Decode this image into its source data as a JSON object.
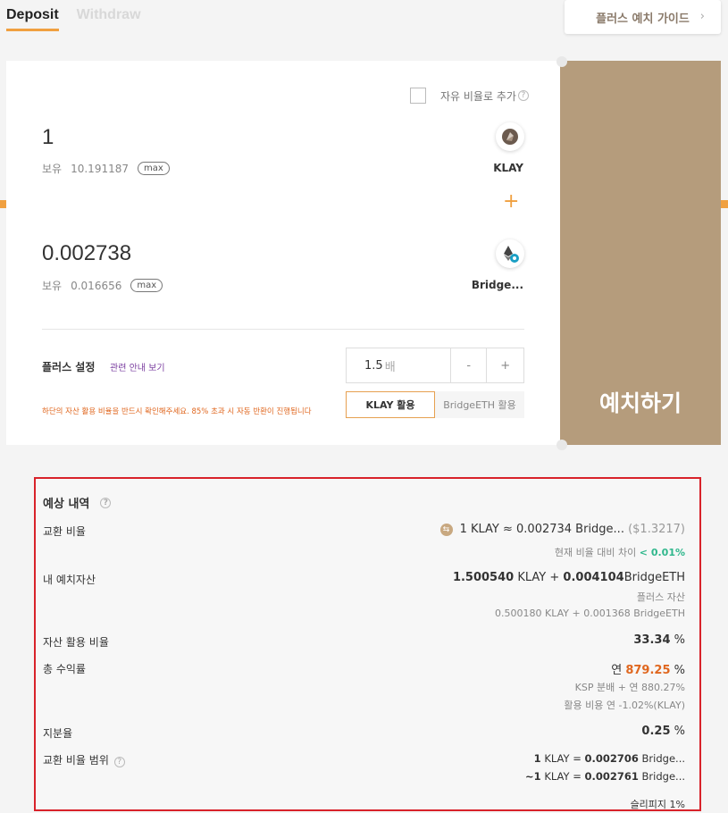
{
  "tabs": [
    {
      "label": "Deposit",
      "active": true
    },
    {
      "label": "Withdraw",
      "active": false
    }
  ],
  "guide_button": {
    "label": "플러스 예치 가이드"
  },
  "free_ratio": {
    "label": "자유 비율로 추가"
  },
  "token_a": {
    "amount": "1",
    "hold_label": "보유",
    "hold_value": "10.191187",
    "max_label": "max",
    "name": "KLAY"
  },
  "token_b": {
    "amount": "0.002738",
    "hold_label": "보유",
    "hold_value": "0.016656",
    "max_label": "max",
    "name": "Bridge..."
  },
  "plus_setting": {
    "label": "플러스 설정",
    "link": "관련 안내 보기",
    "multiplier": "1.5",
    "multiplier_unit": "배",
    "minus": "-",
    "plus": "+",
    "warning": "하단의 자산 활용 비율을 반드시 확인해주세요. 85% 초과 시 자동 반환이 진행됩니다",
    "use_options": [
      "KLAY 활용",
      "BridgeETH 활용"
    ]
  },
  "deposit_button": {
    "label": "예치하기"
  },
  "summary": {
    "title": "예상 내역",
    "exchange_rate": {
      "label": "교환 비율",
      "value": "1 KLAY ≈ 0.002734 Bridge...",
      "usd": "($1.3217)",
      "diff_label": "현재 비율 대비 차이",
      "diff_value": "< 0.01%"
    },
    "my_deposit": {
      "label": "내 예치자산",
      "klay_amount": "1.500540",
      "klay_unit": "KLAY",
      "plus": "+",
      "eth_amount": "0.004104",
      "eth_unit": "BridgeETH",
      "sub_label": "플러스 자산",
      "sub_value": "0.500180 KLAY + 0.001368 BridgeETH"
    },
    "usage_ratio": {
      "label": "자산 활용 비율",
      "value": "33.34",
      "unit": "%"
    },
    "total_yield": {
      "label": "총 수익률",
      "prefix": "연",
      "value": "879.25",
      "unit": "%",
      "sub1": "KSP 분배 + 연 880.27%",
      "sub2": "활용 비용 연 -1.02%(KLAY)"
    },
    "share": {
      "label": "지분율",
      "value": "0.25",
      "unit": "%"
    },
    "range": {
      "label": "교환 비율 범위",
      "line1_prefix": "1",
      "line1_mid": " KLAY = ",
      "line1_value": "0.002706",
      "line1_suffix": " Bridge...",
      "line2_prefix": "~1",
      "line2_mid": " KLAY = ",
      "line2_value": "0.002761",
      "line2_suffix": " Bridge..."
    },
    "slippage": "슬리피지 1%"
  }
}
